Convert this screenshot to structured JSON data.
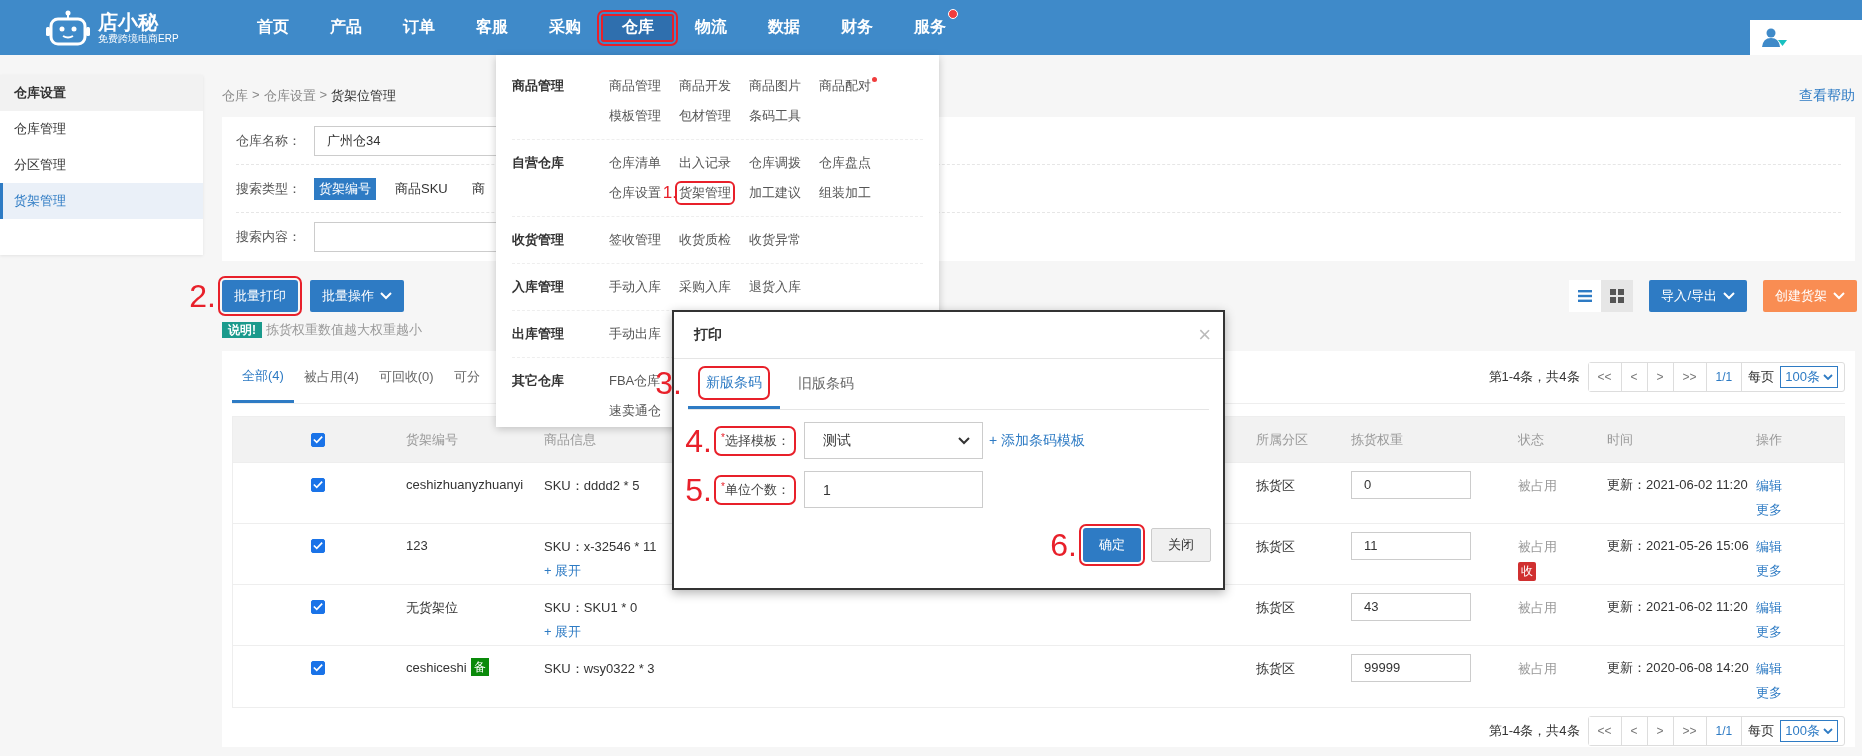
{
  "header": {
    "logo_text": "店小秘",
    "logo_subtitle": "免费跨境电商ERP",
    "nav": [
      {
        "label": "首页",
        "selected": false,
        "highlighted": false,
        "dot": false
      },
      {
        "label": "产品",
        "selected": false,
        "highlighted": false,
        "dot": false
      },
      {
        "label": "订单",
        "selected": false,
        "highlighted": false,
        "dot": false
      },
      {
        "label": "客服",
        "selected": false,
        "highlighted": false,
        "dot": false
      },
      {
        "label": "采购",
        "selected": false,
        "highlighted": false,
        "dot": false
      },
      {
        "label": "仓库",
        "selected": true,
        "highlighted": true,
        "dot": false
      },
      {
        "label": "物流",
        "selected": false,
        "highlighted": false,
        "dot": false
      },
      {
        "label": "数据",
        "selected": false,
        "highlighted": false,
        "dot": false
      },
      {
        "label": "财务",
        "selected": false,
        "highlighted": false,
        "dot": false
      },
      {
        "label": "服务",
        "selected": false,
        "highlighted": false,
        "dot": true
      }
    ]
  },
  "sidebar": {
    "title": "仓库设置",
    "items": [
      {
        "label": "仓库管理",
        "selected": false
      },
      {
        "label": "分区管理",
        "selected": false
      },
      {
        "label": "货架管理",
        "selected": true
      }
    ]
  },
  "breadcrumb": {
    "items": [
      "仓库",
      "仓库设置",
      "货架位管理"
    ],
    "separator": ">"
  },
  "help_link": "查看帮助",
  "filters": {
    "warehouse": {
      "label": "仓库名称：",
      "value": "广州仓34"
    },
    "search_type": {
      "label": "搜索类型：",
      "options": [
        {
          "label": "货架编号",
          "selected": true
        },
        {
          "label": "商品SKU",
          "selected": false
        },
        {
          "label": "商",
          "selected": false
        }
      ]
    },
    "search_content": {
      "label": "搜索内容："
    }
  },
  "actions": {
    "batch_print": {
      "label": "批量打印",
      "step": "2."
    },
    "batch_ops": "批量操作",
    "view_toggle": [
      {
        "kind": "list",
        "selected": true
      },
      {
        "kind": "grid",
        "selected": false
      }
    ],
    "import_export": "导入/导出",
    "create": "创建货架"
  },
  "note": {
    "badge": "说明!",
    "text": "拣货权重数值越大权重越小"
  },
  "tabs": [
    {
      "label": "全部(4)",
      "selected": true
    },
    {
      "label": "被占用(4)",
      "selected": false
    },
    {
      "label": "可回收(0)",
      "selected": false
    },
    {
      "label": "可分",
      "selected": false
    }
  ],
  "pagination_top": {
    "summary": "第1-4条，共4条",
    "buttons": [
      "<<",
      "<",
      ">",
      ">>"
    ],
    "page": "1/1",
    "per_page_label": "每页",
    "per_page": "100条"
  },
  "table": {
    "all_checked": true,
    "columns": [
      "货架编号",
      "商品信息",
      "所属分区",
      "拣货权重",
      "状态",
      "时间",
      "操作"
    ],
    "rows": [
      {
        "checked": true,
        "code": "ceshizhuanyzhuanyi",
        "sku": "SKU：dddd2 * 5",
        "zone": "拣货区",
        "weight": "0",
        "status": "被占用",
        "time": "更新：2021-06-02 11:20",
        "actions": [
          "编辑",
          "更多"
        ]
      },
      {
        "checked": true,
        "code": "123",
        "sku": "SKU：x-32546 * 11",
        "expand": "+ 展开",
        "zone": "拣货区",
        "weight": "11",
        "status": "被占用",
        "status_badge": "收",
        "time": "更新：2021-05-26 15:06",
        "actions": [
          "编辑",
          "更多"
        ]
      },
      {
        "checked": true,
        "code": "无货架位",
        "sku": "SKU：SKU1 * 0",
        "expand": "+ 展开",
        "zone": "拣货区",
        "weight": "43",
        "status": "被占用",
        "time": "更新：2021-06-02 11:20",
        "actions": [
          "编辑",
          "更多"
        ]
      },
      {
        "checked": true,
        "code": "ceshiceshi",
        "tag": "备",
        "sku": "SKU：wsy0322 * 3",
        "zone": "拣货区",
        "weight": "99999",
        "status": "被占用",
        "time": "更新：2020-06-08 14:20",
        "actions": [
          "编辑",
          "更多"
        ]
      }
    ]
  },
  "pagination_bottom": {
    "summary": "第1-4条，共4条",
    "buttons": [
      "<<",
      "<",
      ">",
      ">>"
    ],
    "page": "1/1",
    "per_page_label": "每页",
    "per_page": "100条"
  },
  "menu": {
    "groups": [
      {
        "title": "商品管理",
        "rows": [
          [
            {
              "label": "商品管理"
            },
            {
              "label": "商品开发"
            },
            {
              "label": "商品图片"
            },
            {
              "label": "商品配对",
              "dot": true
            }
          ],
          [
            {
              "label": "模板管理"
            },
            {
              "label": "包材管理"
            },
            {
              "label": "条码工具"
            }
          ]
        ]
      },
      {
        "title": "自营仓库",
        "rows": [
          [
            {
              "label": "仓库清单"
            },
            {
              "label": "出入记录"
            },
            {
              "label": "仓库调拨"
            },
            {
              "label": "仓库盘点"
            }
          ],
          [
            {
              "label": "仓库设置"
            },
            {
              "label": "货架管理",
              "step": "1."
            },
            {
              "label": "加工建议"
            },
            {
              "label": "组装加工"
            }
          ]
        ]
      },
      {
        "title": "收货管理",
        "rows": [
          [
            {
              "label": "签收管理"
            },
            {
              "label": "收货质检"
            },
            {
              "label": "收货异常"
            }
          ]
        ]
      },
      {
        "title": "入库管理",
        "rows": [
          [
            {
              "label": "手动入库"
            },
            {
              "label": "采购入库"
            },
            {
              "label": "退货入库"
            }
          ]
        ]
      },
      {
        "title": "出库管理",
        "rows": [
          [
            {
              "label": "手动出库"
            }
          ]
        ]
      },
      {
        "title": "其它仓库",
        "rows": [
          [
            {
              "label": "FBA仓库"
            }
          ],
          [
            {
              "label": "速卖通仓"
            }
          ]
        ]
      }
    ]
  },
  "dialog": {
    "title": "打印",
    "close": "×",
    "tabs": [
      {
        "label": "新版条码",
        "selected": true,
        "step": "3."
      },
      {
        "label": "旧版条码",
        "selected": false
      }
    ],
    "fields": [
      {
        "kind": "select",
        "required_mark": "*",
        "label": "选择模板：",
        "value": "测试",
        "link": "+ 添加条码模板",
        "step": "4."
      },
      {
        "kind": "input",
        "required_mark": "*",
        "label": "单位个数：",
        "value": "1",
        "step": "5."
      }
    ],
    "confirm": {
      "label": "确定",
      "step": "6."
    },
    "cancel": "关闭"
  }
}
